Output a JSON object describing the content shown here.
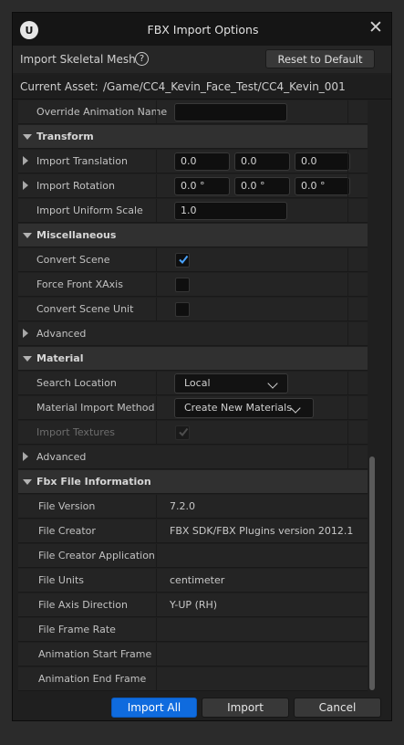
{
  "window": {
    "title": "FBX Import Options",
    "close_icon": "close-icon",
    "logo_icon": "unreal-logo-icon"
  },
  "header": {
    "label": "Import Skeletal Mesh",
    "help_icon": "help-icon",
    "reset_label": "Reset to Default"
  },
  "asset": {
    "label": "Current Asset:",
    "path": "/Game/CC4_Kevin_Face_Test/CC4_Kevin_001"
  },
  "rows": {
    "override_anim_name": {
      "label": "Override Animation Name",
      "value": ""
    },
    "transform": {
      "label": "Transform"
    },
    "import_translation": {
      "label": "Import Translation",
      "x": "0.0",
      "y": "0.0",
      "z": "0.0"
    },
    "import_rotation": {
      "label": "Import Rotation",
      "x": "0.0 °",
      "y": "0.0 °",
      "z": "0.0 °"
    },
    "import_uniform_scale": {
      "label": "Import Uniform Scale",
      "value": "1.0"
    },
    "miscellaneous": {
      "label": "Miscellaneous"
    },
    "convert_scene": {
      "label": "Convert Scene",
      "checked": true
    },
    "force_front_xaxis": {
      "label": "Force Front XAxis",
      "checked": false
    },
    "convert_scene_unit": {
      "label": "Convert Scene Unit",
      "checked": false
    },
    "advanced1": {
      "label": "Advanced"
    },
    "material": {
      "label": "Material"
    },
    "search_location": {
      "label": "Search Location",
      "value": "Local"
    },
    "material_import_method": {
      "label": "Material Import Method",
      "value": "Create New Materials"
    },
    "import_textures": {
      "label": "Import Textures",
      "checked": true
    },
    "advanced2": {
      "label": "Advanced"
    },
    "fbx_file_info": {
      "label": "Fbx File Information"
    },
    "file_version": {
      "label": "File Version",
      "value": "7.2.0"
    },
    "file_creator": {
      "label": "File Creator",
      "value": "FBX SDK/FBX Plugins version 2012.1"
    },
    "file_creator_app": {
      "label": "File Creator Application",
      "value": ""
    },
    "file_units": {
      "label": "File Units",
      "value": "centimeter"
    },
    "file_axis_direction": {
      "label": "File Axis Direction",
      "value": "Y-UP (RH)"
    },
    "file_frame_rate": {
      "label": "File Frame Rate",
      "value": ""
    },
    "anim_start_frame": {
      "label": "Animation Start Frame",
      "value": ""
    },
    "anim_end_frame": {
      "label": "Animation End Frame",
      "value": ""
    }
  },
  "footer": {
    "import_all": "Import All",
    "import": "Import",
    "cancel": "Cancel"
  },
  "colors": {
    "primary": "#0f6bde",
    "panel": "#242424",
    "category": "#303030"
  }
}
